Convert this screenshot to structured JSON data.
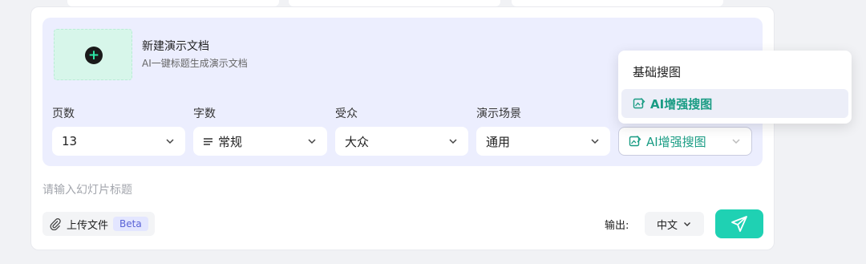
{
  "new_doc": {
    "title": "新建演示文档",
    "subtitle": "AI一键标题生成演示文档"
  },
  "fields": {
    "pages": {
      "label": "页数",
      "value": "13"
    },
    "words": {
      "label": "字数",
      "value": "常规"
    },
    "audience": {
      "label": "受众",
      "value": "大众"
    },
    "scene": {
      "label": "演示场景",
      "value": "通用"
    },
    "image": {
      "value": "AI增强搜图"
    }
  },
  "input": {
    "placeholder": "请输入幻灯片标题"
  },
  "upload": {
    "label": "上传文件",
    "badge": "Beta"
  },
  "output": {
    "label": "输出:",
    "language": "中文"
  },
  "dropdown": {
    "options": [
      "基础搜图",
      "AI增强搜图"
    ],
    "selected": "AI增强搜图"
  },
  "colors": {
    "accent": "#1fd1b3",
    "accent_text": "#1a9c84",
    "panel_bg": "#eceefe"
  }
}
